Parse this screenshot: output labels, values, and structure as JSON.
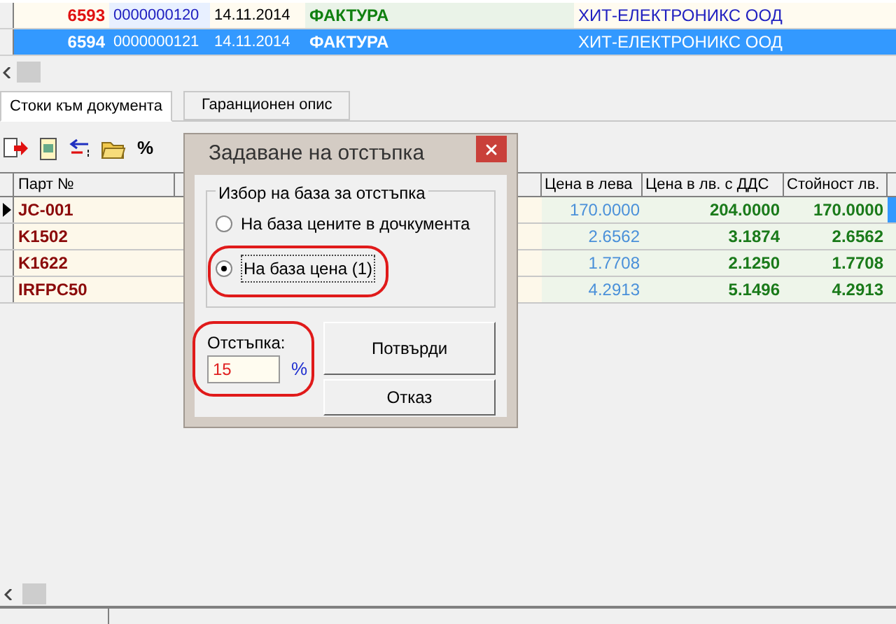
{
  "documents": {
    "rows": [
      {
        "number": "6593",
        "doc_no": "0000000120",
        "date": "14.11.2014",
        "type": "ФАКТУРА",
        "company": "ХИТ-ЕЛЕКТРОНИКС ООД",
        "selected": false
      },
      {
        "number": "6594",
        "doc_no": "0000000121",
        "date": "14.11.2014",
        "type": "ФАКТУРА",
        "company": "ХИТ-ЕЛЕКТРОНИКС ООД",
        "selected": true
      }
    ]
  },
  "tabs": [
    {
      "label": "Стоки към документа",
      "selected": true
    },
    {
      "label": "Гаранционен опис",
      "selected": false
    }
  ],
  "toolbar": {
    "percent_label": "%"
  },
  "items": {
    "columns": [
      "Парт №",
      "Цена в лева",
      "Цена в лв. с ДДС",
      "Стойност лв."
    ],
    "rows": [
      {
        "part": "JC-001",
        "price": "170.0000",
        "price_vat": "204.0000",
        "value": "170.0000",
        "current": true
      },
      {
        "part": "K1502",
        "price": "2.6562",
        "price_vat": "3.1874",
        "value": "2.6562",
        "current": false
      },
      {
        "part": "K1622",
        "price": "1.7708",
        "price_vat": "2.1250",
        "value": "1.7708",
        "current": false
      },
      {
        "part": "IRFPC50",
        "price": "4.2913",
        "price_vat": "5.1496",
        "value": "4.2913",
        "current": false
      }
    ]
  },
  "dialog": {
    "title": "Задаване на отстъпка",
    "group_label": "Избор на база за отстъпка",
    "options": [
      {
        "label": "На база цените в дочкумента",
        "selected": false
      },
      {
        "label": "На база цена (1)",
        "selected": true
      }
    ],
    "discount_label": "Отстъпка:",
    "discount_value": "15",
    "unit": "%",
    "buttons": [
      "Потвърди",
      "Отказ"
    ]
  }
}
